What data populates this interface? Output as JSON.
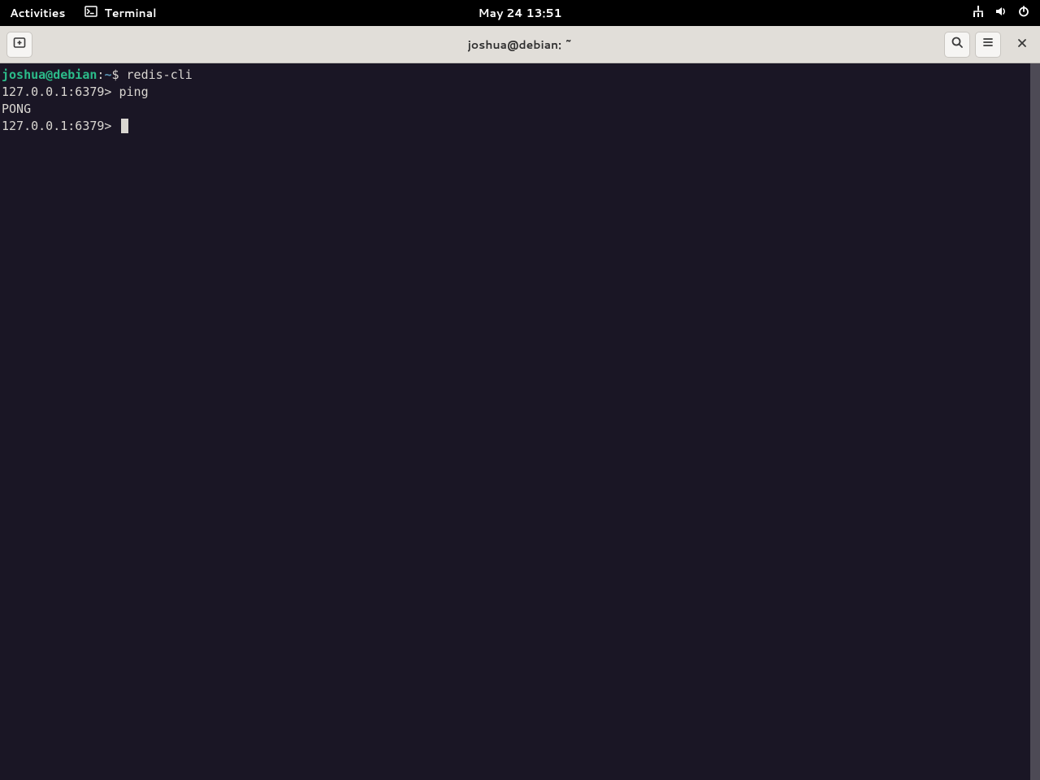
{
  "panel": {
    "activities": "Activities",
    "app_name": "Terminal",
    "datetime": "May 24  13:51"
  },
  "window": {
    "title": "joshua@debian: ~"
  },
  "terminal": {
    "user_host": "joshua@debian",
    "colon": ":",
    "tilde": "~",
    "dollar": "$ ",
    "command1": "redis-cli",
    "line2_prompt": "127.0.0.1:6379> ",
    "line2_cmd": "ping",
    "line3_response": "PONG",
    "line4_prompt": "127.0.0.1:6379> "
  }
}
